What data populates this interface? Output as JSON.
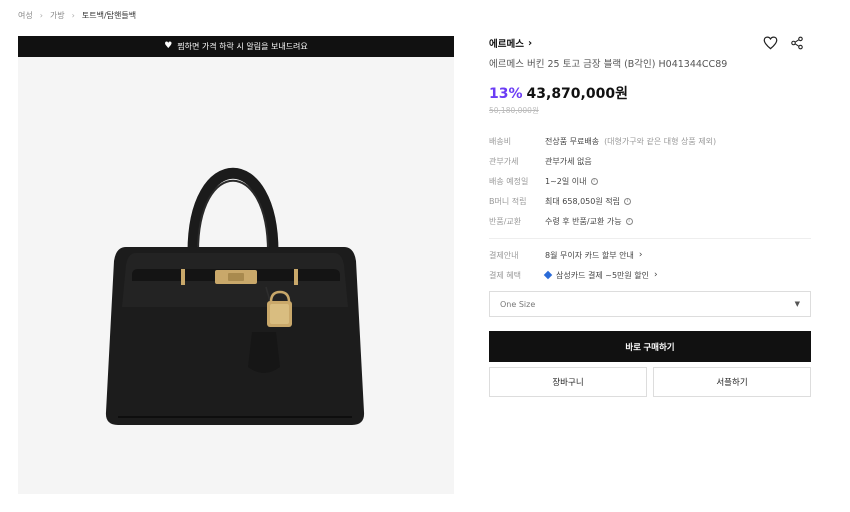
{
  "breadcrumb": [
    "여성",
    "가방",
    "토트백/탑핸들백"
  ],
  "banner": {
    "text": "찜하면 가격 하락 시 알림을 보내드려요"
  },
  "product": {
    "brand": "에르메스",
    "name": "에르메스 버킨 25 토고 금장 블랙 (B각인) H041344CC89",
    "discount": "13%",
    "price": "43,870,000원",
    "original_price": "50,180,000원"
  },
  "details": [
    {
      "label": "배송비",
      "value": "전상품 무료배송",
      "note": "(대형가구와 같은 대형 상품 제외)"
    },
    {
      "label": "관부가세",
      "value": "관부가세 없음"
    },
    {
      "label": "배송 예정일",
      "value": "1~2일 이내"
    },
    {
      "label": "B머니 적립",
      "value": "최대 658,050원 적립"
    },
    {
      "label": "반품/교환",
      "value": "수령 후 반품/교환 가능"
    }
  ],
  "payment": [
    {
      "label": "결제안내",
      "value": "8월 무이자 카드 할부 안내"
    },
    {
      "label": "결제 혜택",
      "value": "삼성카드 결제 ~5만원 할인"
    }
  ],
  "option": {
    "selected": "One Size"
  },
  "buttons": {
    "buy": "바로 구매하기",
    "cart": "장바구니",
    "gift": "서플하기"
  },
  "colors": {
    "accent": "#6b3cf5",
    "dark": "#111111"
  }
}
